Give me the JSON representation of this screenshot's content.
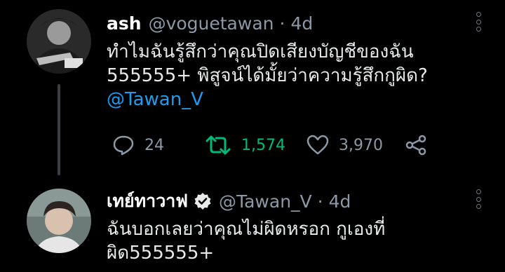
{
  "tweet1": {
    "display_name": "ash",
    "handle": "@voguetawan",
    "separator": "·",
    "time": "4d",
    "text_lines": [
      "ทำไมฉันรู้สึกว่าคุณปิดเสียงบัญชีของฉัน",
      "555555+ พิสูจน์ได้มั้ยว่าความรู้สึกกูผิด?"
    ],
    "mention": "@Tawan_V",
    "reply_count": "24",
    "retweet_count": "1,574",
    "like_count": "3,970",
    "icons": [
      "reply-icon",
      "retweet-icon",
      "like-icon",
      "share-icon",
      "more-icon"
    ]
  },
  "tweet2": {
    "display_name": "เทย์ทาวาฟ",
    "handle": "@Tawan_V",
    "separator": "·",
    "time": "4d",
    "text_lines": [
      "ฉันบอกเลยว่าคุณไม่ผิดหรอก กูเองที่",
      "ผิด555555+"
    ],
    "icons": [
      "verified-icon",
      "more-icon"
    ]
  },
  "colors": {
    "background": "#000000",
    "text": "#e7e9ea",
    "secondary": "#8b98a5",
    "mention": "#1d9bf0",
    "retweeted": "#00ba7c",
    "thread_line": "#3a3f44"
  }
}
